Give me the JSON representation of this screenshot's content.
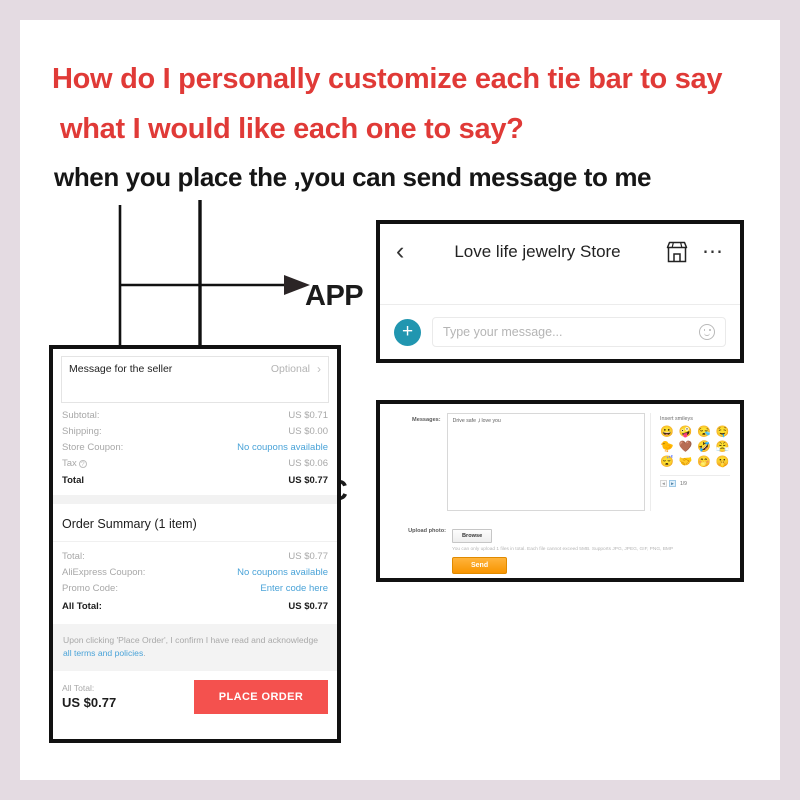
{
  "headline": {
    "line1": "How do I personally  customize each tie bar to say",
    "line2": "what I would like each one to say?",
    "line3": "when you place the ,you can send message to me",
    "red_color": "#e03a37",
    "black_color": "#161616"
  },
  "annotations": {
    "app_label": "APP",
    "pc_label": "PC"
  },
  "checkout": {
    "message_seller": {
      "label": "Message for the seller",
      "value": "Optional",
      "chevron": "chevron-right-icon"
    },
    "rows": [
      {
        "label": "Subtotal:",
        "value": "US $0.71",
        "link": false
      },
      {
        "label": "Shipping:",
        "value": "US $0.00",
        "link": false
      },
      {
        "label": "Store Coupon:",
        "value": "No coupons available",
        "link": true
      },
      {
        "label": "Tax",
        "value": "US $0.06",
        "link": false,
        "help": "?"
      },
      {
        "label": "Total",
        "value": "US $0.77",
        "link": false,
        "bold": true
      }
    ],
    "summary": {
      "title": "Order Summary (1 item)",
      "rows": [
        {
          "label": "Total:",
          "value": "US $0.77",
          "link": false
        },
        {
          "label": "AliExpress Coupon:",
          "value": "No coupons available",
          "link": true
        },
        {
          "label": "Promo Code:",
          "value": "Enter code here",
          "link": true
        },
        {
          "label": "All Total:",
          "value": "US $0.77",
          "link": false,
          "bold": true
        }
      ]
    },
    "terms": {
      "text_before": "Upon clicking 'Place Order', I confirm I have read and acknowledge ",
      "link": "all terms and policies",
      "text_after": "."
    },
    "footer": {
      "total_caption": "All Total:",
      "total_amount": "US $0.77",
      "place_order_label": "PLACE ORDER",
      "place_order_color": "#f4514e"
    }
  },
  "chat": {
    "back_icon": "back-chevron-icon",
    "title": "Love life jewelry Store",
    "store_icon": "store-icon",
    "more_icon": "more-options-icon",
    "plus_icon": "add-attachment-icon",
    "plus_color": "#2196b0",
    "input_placeholder": "Type your message...",
    "emoji_icon": "smiley-face-icon"
  },
  "pcform": {
    "messages_label": "Messages:",
    "messages_value": "Drive safe ,i love you",
    "smileys_title": "Insert smileys",
    "emojis": [
      "😀",
      "🤪",
      "😪",
      "🤤",
      "🐤",
      "🤎",
      "🤣",
      "😤",
      "😴",
      "🤝",
      "🤭",
      "🤫"
    ],
    "pager": {
      "prev": "◄",
      "next": "►",
      "count": "1/9"
    },
    "upload_label": "Upload photo:",
    "browse_label": "Browse",
    "upload_hint": "You can only upload 1 files in total. Each file cannot exceed 5MB. Supports JPG, JPEG, GIF, PNG, BMP",
    "send_label": "Send",
    "send_color": "#f79400"
  }
}
